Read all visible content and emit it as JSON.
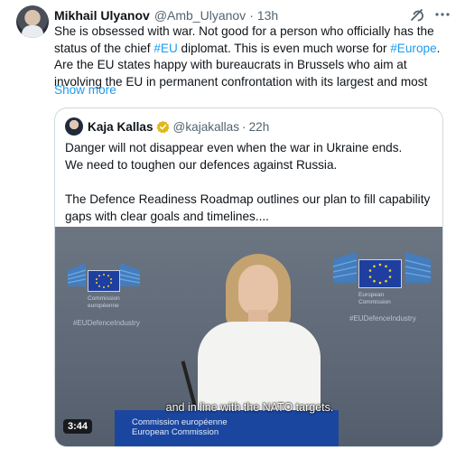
{
  "tweet": {
    "author_name": "Mikhail Ulyanov",
    "author_handle": "@Amb_Ulyanov",
    "separator": "·",
    "time": "13h",
    "more_icon": "more-horizontal-icon",
    "grok_icon": "grok-icon",
    "text_1": "She is obsessed with war.  Not good for a person who officially has the status of the chief ",
    "tag_1": "#EU",
    "text_2": " diplomat. This is even much worse for ",
    "tag_2": "#Europe",
    "text_3": ". Are the EU states happy with bureaucrats in Brussels who aim at involving  the EU in permanent confrontation with its  largest and most",
    "show_more": "Show more"
  },
  "quote": {
    "author_name": "Kaja Kallas",
    "author_handle": "@kajakallas",
    "separator": "·",
    "time": "22h",
    "line_1": "Danger will not disappear even when the war in Ukraine ends.",
    "line_2": "We need to toughen our defences against Russia.",
    "line_3": "The Defence Readiness Roadmap outlines our plan to fill capability gaps with clear goals and timelines....",
    "video": {
      "logo_left_caption_1": "Commission",
      "logo_left_caption_2": "européenne",
      "logo_right_caption_1": "European",
      "logo_right_caption_2": "Commission",
      "hashtag_left": "#EUDefenceIndustry",
      "hashtag_right": "#EUDefenceIndustry",
      "podium_line_1": "Commission européenne",
      "podium_line_2": "European Commission",
      "subtitle": "and in line with the NATO targets.",
      "duration": "3:44"
    }
  },
  "colors": {
    "link": "#1d9bf0",
    "secondary_text": "#536471",
    "verified_gold": "#e2b719",
    "eu_blue": "#1e3f9f"
  }
}
